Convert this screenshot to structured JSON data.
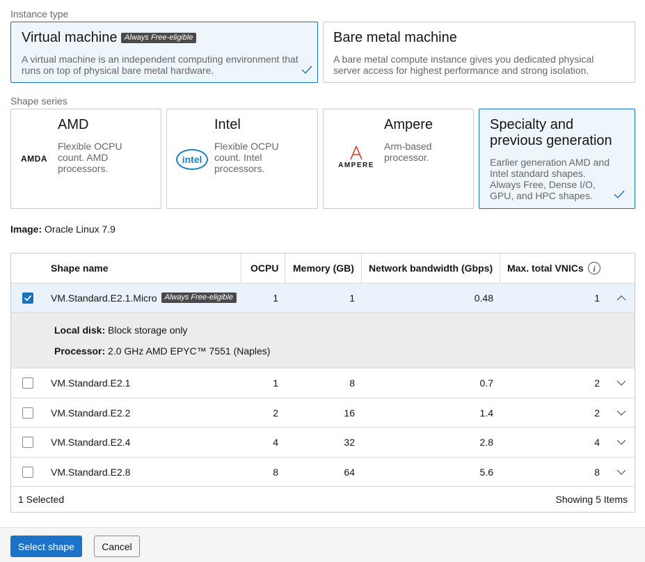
{
  "instance_type": {
    "label": "Instance type",
    "options": [
      {
        "title": "Virtual machine",
        "badge": "Always Free-eligible",
        "desc_line1": "A virtual machine is an independent computing environment that",
        "desc_line2": "runs on top of physical bare metal hardware.",
        "selected": true
      },
      {
        "title": "Bare metal machine",
        "desc_line1": "A bare metal compute instance gives you dedicated physical",
        "desc_line2": "server access for highest performance and strong isolation.",
        "selected": false
      }
    ]
  },
  "shape_series": {
    "label": "Shape series",
    "options": [
      {
        "title": "AMD",
        "logo_text": "AMDA",
        "desc": [
          "Flexible OCPU",
          "count. AMD",
          "processors."
        ],
        "selected": false
      },
      {
        "title": "Intel",
        "logo_text": "intel",
        "desc": [
          "Flexible OCPU",
          "count. Intel",
          "processors."
        ],
        "selected": false
      },
      {
        "title": "Ampere",
        "logo_text": "AMPERE",
        "desc": [
          "Arm-based",
          "processor."
        ],
        "selected": false
      },
      {
        "title_line1": "Specialty and",
        "title_line2": "previous generation",
        "desc": [
          "Earlier generation AMD and",
          "Intel standard shapes.",
          "Always Free, Dense I/O,",
          "GPU, and HPC shapes."
        ],
        "selected": true
      }
    ]
  },
  "image": {
    "label": "Image:",
    "value": "Oracle Linux 7.9"
  },
  "table": {
    "columns": [
      "Shape name",
      "OCPU",
      "Memory (GB)",
      "Network bandwidth (Gbps)",
      "Max. total VNICs"
    ],
    "rows": [
      {
        "name": "VM.Standard.E2.1.Micro",
        "badge": "Always Free-eligible",
        "ocpu": "1",
        "memory": "1",
        "bandwidth": "0.48",
        "vnics": "1",
        "checked": true,
        "expanded": true
      },
      {
        "name": "VM.Standard.E2.1",
        "ocpu": "1",
        "memory": "8",
        "bandwidth": "0.7",
        "vnics": "2",
        "checked": false
      },
      {
        "name": "VM.Standard.E2.2",
        "ocpu": "2",
        "memory": "16",
        "bandwidth": "1.4",
        "vnics": "2",
        "checked": false
      },
      {
        "name": "VM.Standard.E2.4",
        "ocpu": "4",
        "memory": "32",
        "bandwidth": "2.8",
        "vnics": "4",
        "checked": false
      },
      {
        "name": "VM.Standard.E2.8",
        "ocpu": "8",
        "memory": "64",
        "bandwidth": "5.6",
        "vnics": "8",
        "checked": false
      }
    ],
    "detail": {
      "disk_label": "Local disk:",
      "disk_value": "Block storage only",
      "processor_label": "Processor:",
      "processor_value": "2.0 GHz AMD EPYC™ 7551 (Naples)"
    },
    "footer": {
      "selected": "1 Selected",
      "showing": "Showing 5 Items"
    }
  },
  "actions": {
    "primary": "Select shape",
    "secondary": "Cancel"
  },
  "colors": {
    "accent": "#1a73b8",
    "selected_bg": "#eef5fb",
    "badge_bg": "#4a4a4a"
  }
}
